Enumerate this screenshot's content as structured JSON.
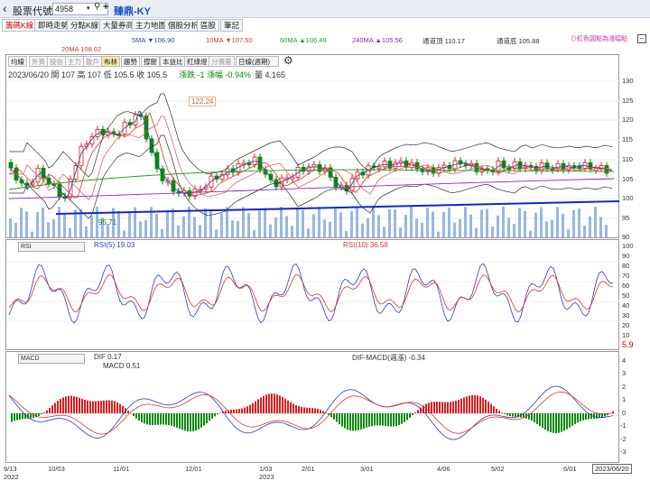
{
  "header": {
    "back_icon": "chevron-left-icon",
    "code_label": "股票代號",
    "code_value": "4958",
    "stock_name": "臻鼎-KY"
  },
  "tabs": [
    "籌碼K線",
    "即時走勢",
    "分點K線",
    "大量券商",
    "主力地圖",
    "個股分析",
    "區股",
    "筆記"
  ],
  "ma_legend": {
    "ma20": "20MA 108.02",
    "ma5": "5MA ▼106.90",
    "ma10": "10MA ▼107.50",
    "ma60": "60MA ▲106.49",
    "ma240": "240MA ▲105.56",
    "upper_channel": "通道頂 110.17",
    "lower_channel": "通道底 105.88",
    "marker_note": "⊙紅色圓點為漲幅點"
  },
  "toolbar": {
    "items": [
      "均線",
      "外資",
      "投信",
      "主力",
      "散戶",
      "布林",
      "趨勢",
      "撐壓",
      "本益比",
      "紅綠燈",
      "分價量"
    ],
    "period": "日線(週期)"
  },
  "quote": {
    "line": "2023/06/20 開 107  高 107  低 105.5  收 105.5",
    "change": "漲跌 -1  漲幅 -0.94%",
    "volume": "量 4,165"
  },
  "price_panel": {
    "high_annotation": "122.24",
    "low_annotation": "95.71",
    "y_ticks": [
      "130",
      "125",
      "120",
      "115",
      "110",
      "105",
      "100",
      "95",
      "90"
    ]
  },
  "rsi_panel": {
    "selector": "RSI",
    "rsi5": "RSI(5) 19.03",
    "rsi10": "RSI(10) 36.58",
    "y_ticks": [
      "100",
      "90",
      "80",
      "70",
      "60",
      "50",
      "40",
      "30",
      "20",
      "10",
      "0"
    ],
    "last_value": "5.9"
  },
  "macd_panel": {
    "selector": "MACD",
    "dif": "DIF 0.17",
    "macd": "MACD 0.51",
    "osc": "DIF-MACD(週漲) -0.34",
    "y_ticks": [
      "4",
      "3",
      "2",
      "1",
      "0",
      "-1",
      "-2",
      "-3"
    ]
  },
  "x_axis": {
    "dates": [
      "9/13",
      "10/03",
      "11/01",
      "12/01",
      "1/03",
      "2/01",
      "3/01",
      "4/06",
      "5/02",
      "6/01"
    ],
    "year_2022": "2022",
    "year_2023": "2023",
    "current_date": "2023/06/20"
  },
  "colors": {
    "up": "#e21b1b",
    "down": "#0a8a0a",
    "ma5": "#2b3fb3",
    "ma10": "#e0352c",
    "ma20": "#c66",
    "ma60": "#2a9a2a",
    "ma240": "#8a2bb0",
    "trendline": "#1525c8",
    "volume": "#6b9ad8"
  }
}
